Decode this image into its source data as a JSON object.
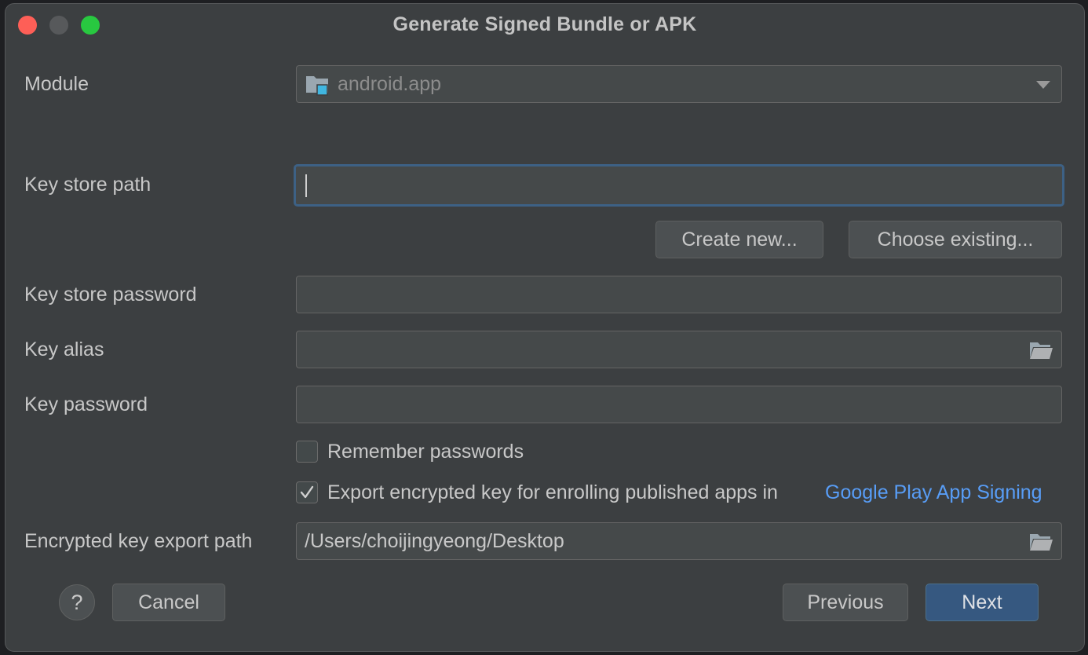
{
  "window": {
    "title": "Generate Signed Bundle or APK"
  },
  "module": {
    "label": "Module",
    "value": "android.app",
    "icon": "module-folder-icon"
  },
  "keystore": {
    "path_label": "Key store path",
    "path_value": "",
    "create_new": "Create new...",
    "choose_existing": "Choose existing...",
    "password_label": "Key store password",
    "password_value": ""
  },
  "key": {
    "alias_label": "Key alias",
    "alias_value": "",
    "password_label": "Key password",
    "password_value": ""
  },
  "options": {
    "remember_passwords": {
      "label": "Remember passwords",
      "checked": false
    },
    "export_key": {
      "label": "Export encrypted key for enrolling published apps in",
      "link": "Google Play App Signing",
      "checked": true
    }
  },
  "export_path": {
    "label": "Encrypted key export path",
    "value": "/Users/choijingyeong/Desktop"
  },
  "footer": {
    "help": "?",
    "cancel": "Cancel",
    "previous": "Previous",
    "next": "Next"
  },
  "colors": {
    "background": "#3c3f41",
    "field": "#45494a",
    "focus_border": "#3d6185",
    "primary_button": "#365880",
    "link": "#589df6"
  }
}
